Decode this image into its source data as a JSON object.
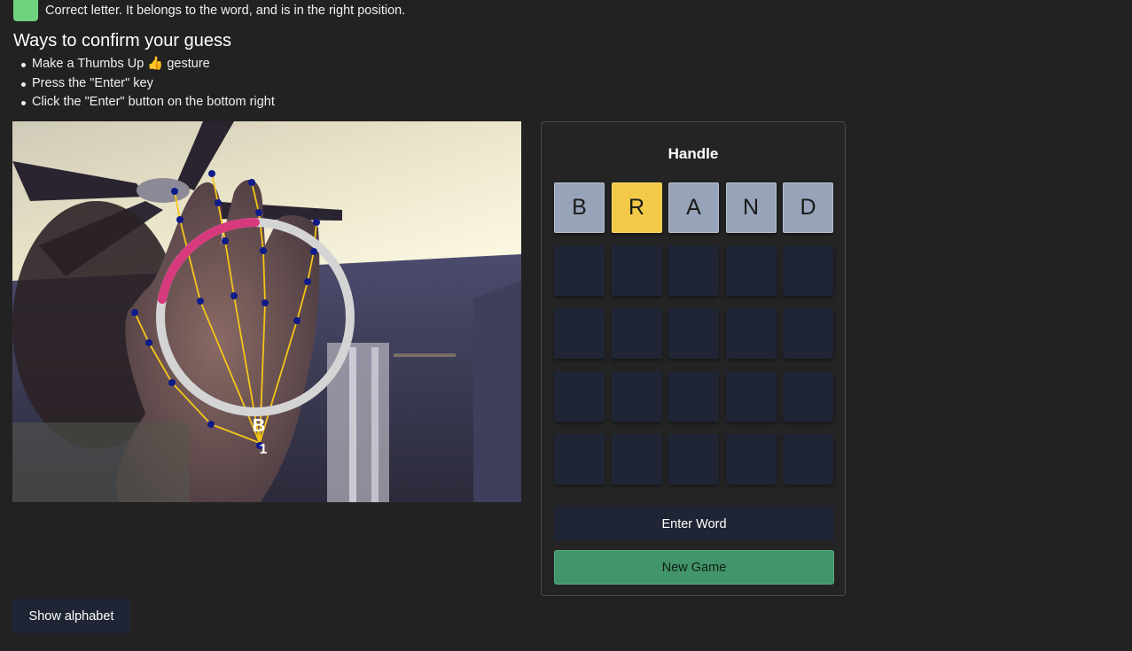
{
  "legend": {
    "correct_color": "#6fd27f",
    "correct_text": "Correct letter. It belongs to the word, and is in the right position."
  },
  "confirm": {
    "heading": "Ways to confirm your guess",
    "items": [
      "Make a Thumbs Up 👍 gesture",
      "Press the \"Enter\" key",
      "Click the \"Enter\" button on the bottom right"
    ]
  },
  "camera": {
    "current_letter": "B",
    "hold_count": "1",
    "hold_progress": 0.22,
    "ring_color": "#d4d4d4",
    "progress_color": "#d63a7c",
    "skeleton_color": "#f5c518",
    "landmark_color": "#101b8a"
  },
  "game": {
    "title": "Handle",
    "rows": [
      [
        {
          "letter": "B",
          "state": "absent"
        },
        {
          "letter": "R",
          "state": "present"
        },
        {
          "letter": "A",
          "state": "absent"
        },
        {
          "letter": "N",
          "state": "absent"
        },
        {
          "letter": "D",
          "state": "absent"
        }
      ],
      [
        {
          "letter": "",
          "state": "empty"
        },
        {
          "letter": "",
          "state": "empty"
        },
        {
          "letter": "",
          "state": "empty"
        },
        {
          "letter": "",
          "state": "empty"
        },
        {
          "letter": "",
          "state": "empty"
        }
      ],
      [
        {
          "letter": "",
          "state": "empty"
        },
        {
          "letter": "",
          "state": "empty"
        },
        {
          "letter": "",
          "state": "empty"
        },
        {
          "letter": "",
          "state": "empty"
        },
        {
          "letter": "",
          "state": "empty"
        }
      ],
      [
        {
          "letter": "",
          "state": "empty"
        },
        {
          "letter": "",
          "state": "empty"
        },
        {
          "letter": "",
          "state": "empty"
        },
        {
          "letter": "",
          "state": "empty"
        },
        {
          "letter": "",
          "state": "empty"
        }
      ],
      [
        {
          "letter": "",
          "state": "empty"
        },
        {
          "letter": "",
          "state": "empty"
        },
        {
          "letter": "",
          "state": "empty"
        },
        {
          "letter": "",
          "state": "empty"
        },
        {
          "letter": "",
          "state": "empty"
        }
      ]
    ],
    "enter_label": "Enter Word",
    "new_game_label": "New Game"
  },
  "show_alphabet_label": "Show alphabet"
}
